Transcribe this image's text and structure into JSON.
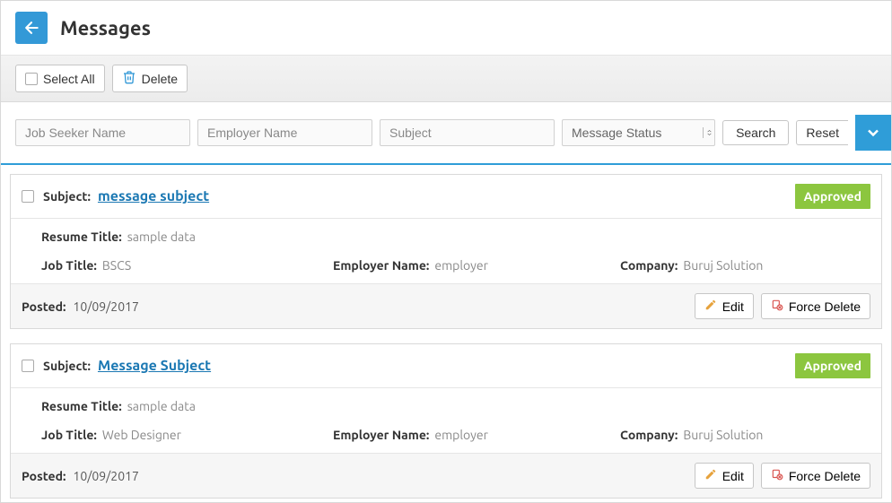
{
  "header": {
    "title": "Messages"
  },
  "actions": {
    "select_all": "Select All",
    "delete": "Delete"
  },
  "filters": {
    "seeker_placeholder": "Job Seeker Name",
    "employer_placeholder": "Employer Name",
    "subject_placeholder": "Subject",
    "status_label": "Message Status",
    "search": "Search",
    "reset": "Reset"
  },
  "labels": {
    "subject": "Subject:",
    "resume_title": "Resume Title:",
    "job_title": "Job Title:",
    "employer_name": "Employer Name:",
    "company": "Company:",
    "posted": "Posted:",
    "edit": "Edit",
    "force_delete": "Force Delete"
  },
  "messages": [
    {
      "subject": "message subject",
      "status": "Approved",
      "resume_title": "sample data",
      "job_title": "BSCS",
      "employer_name": "employer",
      "company": "Buruj Solution",
      "posted": "10/09/2017"
    },
    {
      "subject": "Message Subject",
      "status": "Approved",
      "resume_title": "sample data",
      "job_title": "Web Designer",
      "employer_name": "employer",
      "company": "Buruj Solution",
      "posted": "10/09/2017"
    }
  ]
}
